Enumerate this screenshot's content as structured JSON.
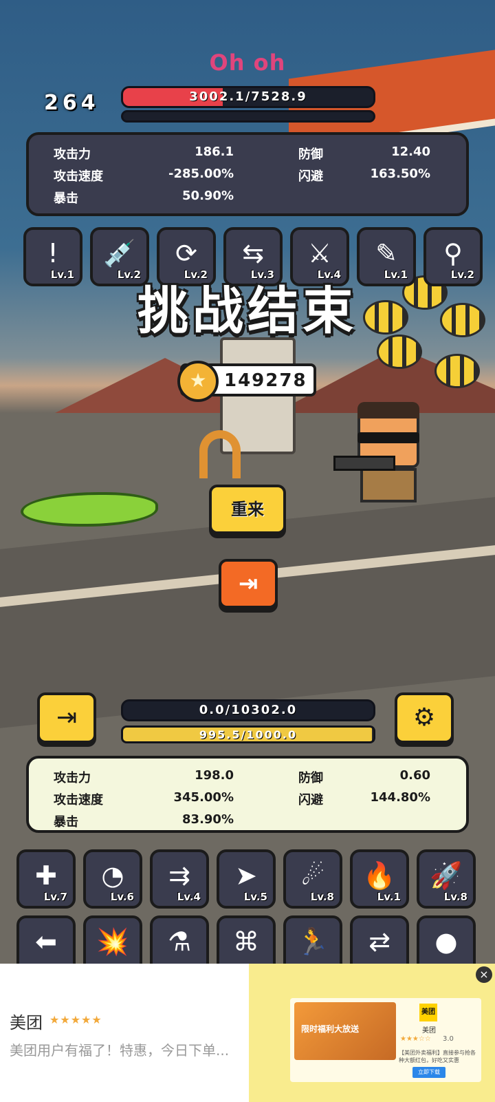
{
  "header": {
    "title": "Oh oh",
    "level": "264"
  },
  "enemy": {
    "hp_text": "3002.1/7528.9",
    "hp_fraction": 0.399,
    "stats": [
      {
        "label": "攻击力",
        "value": "186.1",
        "label2": "防御",
        "value2": "12.40"
      },
      {
        "label": "攻击速度",
        "value": "-285.00%",
        "label2": "闪避",
        "value2": "163.50%"
      },
      {
        "label": "暴击",
        "value": "50.90%",
        "label2": "",
        "value2": ""
      }
    ],
    "skills": [
      {
        "icon": "warning-potion-icon",
        "glyph": "!",
        "level": "Lv.1"
      },
      {
        "icon": "syringe-icon",
        "glyph": "💉",
        "level": "Lv.2"
      },
      {
        "icon": "refresh-cycle-icon",
        "glyph": "⟳",
        "level": "Lv.2"
      },
      {
        "icon": "green-arrows-icon",
        "glyph": "⇆",
        "level": "Lv.3"
      },
      {
        "icon": "crossed-swords-icon",
        "glyph": "⚔",
        "level": "Lv.4"
      },
      {
        "icon": "blood-syringe-icon",
        "glyph": "✎",
        "level": "Lv.1"
      },
      {
        "icon": "shotgun-icon",
        "glyph": "⚲",
        "level": "Lv.2"
      }
    ]
  },
  "result": {
    "title": "挑战结束",
    "coins": "149278",
    "retry_label": "重来",
    "exit_icon": "exit-door-icon"
  },
  "player": {
    "hp_text": "0.0/10302.0",
    "hp_fraction": 0.0,
    "xp_text": "995.5/1000.0",
    "xp_fraction": 0.9955,
    "stats": [
      {
        "label": "攻击力",
        "value": "198.0",
        "label2": "防御",
        "value2": "0.60"
      },
      {
        "label": "攻击速度",
        "value": "345.00%",
        "label2": "闪避",
        "value2": "144.80%"
      },
      {
        "label": "暴击",
        "value": "83.90%",
        "label2": "",
        "value2": ""
      }
    ],
    "skills_row1": [
      {
        "icon": "medkit-icon",
        "glyph": "✚",
        "level": "Lv.7"
      },
      {
        "icon": "speed-gauge-icon",
        "glyph": "◔",
        "level": "Lv.6"
      },
      {
        "icon": "double-arrow-icon",
        "glyph": "⇉",
        "level": "Lv.4"
      },
      {
        "icon": "paper-plane-icon",
        "glyph": "➤",
        "level": "Lv.5"
      },
      {
        "icon": "shooting-star-icon",
        "glyph": "☄",
        "level": "Lv.8"
      },
      {
        "icon": "flame-icon",
        "glyph": "🔥",
        "level": "Lv.1"
      },
      {
        "icon": "rocket-icon",
        "glyph": "🚀",
        "level": "Lv.8"
      }
    ],
    "skills_row2": [
      {
        "icon": "left-arrow-icon",
        "glyph": "⬅",
        "level": ""
      },
      {
        "icon": "explosion-icon",
        "glyph": "💥",
        "level": ""
      },
      {
        "icon": "potion-icon",
        "glyph": "⚗",
        "level": ""
      },
      {
        "icon": "network-icon",
        "glyph": "⌘",
        "level": ""
      },
      {
        "icon": "runner-icon",
        "glyph": "🏃",
        "level": ""
      },
      {
        "icon": "swap-arrows-icon",
        "glyph": "⇄",
        "level": ""
      },
      {
        "icon": "fireball-icon",
        "glyph": "●",
        "level": ""
      }
    ]
  },
  "ad": {
    "name": "美团",
    "stars": "★★★★★",
    "description": "美团用户有福了！特惠，今日下单...",
    "brand_logo": "美团",
    "brand_name": "美团",
    "rating_stars": "★★★☆☆",
    "rating_score": "3.0",
    "detail": "【美团外卖福利】直接参与抢各种大额红包，好吃又实惠",
    "thumb_text": "限时福利大放送",
    "download_label": "立即下载",
    "close_label": "×"
  },
  "colors": {
    "enemy_hp": "#e8414a",
    "xp": "#f0c942",
    "accent_yellow": "#fbd03a",
    "accent_orange": "#f36a25",
    "title_pink": "#e0457c"
  }
}
